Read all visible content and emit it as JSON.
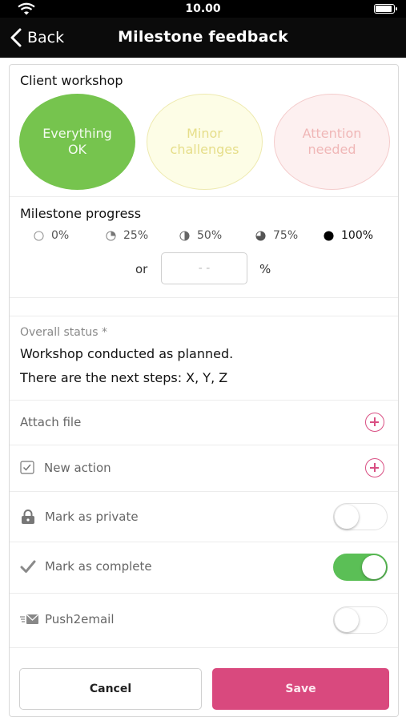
{
  "status_bar": {
    "time": "10.00"
  },
  "nav": {
    "back_label": "Back",
    "title": "Milestone feedback"
  },
  "workshop": {
    "title": "Client workshop",
    "options": [
      {
        "line1": "Everything",
        "line2": "OK",
        "selected": true
      },
      {
        "line1": "Minor",
        "line2": "challenges",
        "selected": false
      },
      {
        "line1": "Attention",
        "line2": "needed",
        "selected": false
      }
    ]
  },
  "progress": {
    "title": "Milestone progress",
    "options": [
      "0%",
      "25%",
      "50%",
      "75%",
      "100%"
    ],
    "selected": "100%",
    "or_label": "or",
    "input_placeholder": "- -",
    "input_value": "",
    "percent_label": "%"
  },
  "overall_status": {
    "label": "Overall status *",
    "line1": "Workshop conducted as planned.",
    "line2": "There are the next steps: X, Y, Z"
  },
  "attach_file": {
    "label": "Attach file"
  },
  "new_action": {
    "label": "New action"
  },
  "mark_private": {
    "label": "Mark as private",
    "enabled": false
  },
  "mark_complete": {
    "label": "Mark as complete",
    "enabled": true
  },
  "push2email": {
    "label": "Push2email",
    "enabled": false
  },
  "actions": {
    "cancel_label": "Cancel",
    "save_label": "Save"
  },
  "colors": {
    "accent": "#d9497e",
    "ok_green": "#76c44e",
    "toggle_on": "#5bbf56",
    "nav_bg": "#0b0b0b"
  }
}
